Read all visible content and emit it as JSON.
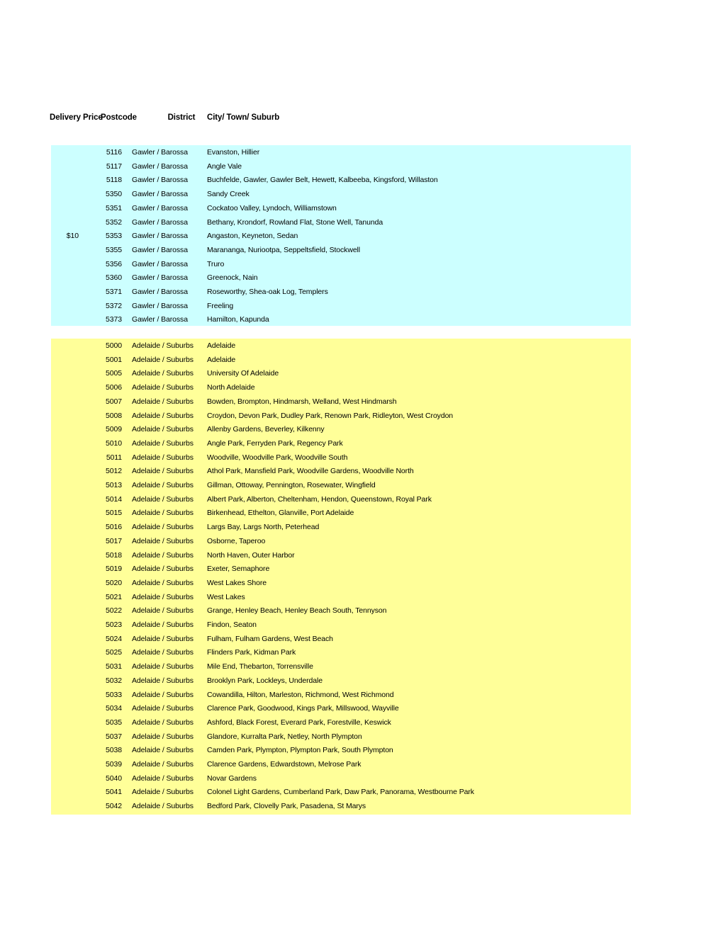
{
  "table": {
    "headers": {
      "delivery_price": "Delivery Price",
      "postcode": "Postcode",
      "district": "District",
      "city_town_suburb": "City/ Town/ Suburb"
    },
    "colors": {
      "gawler_block": "#CCFFFF",
      "adelaide_block": "#FFFF99"
    },
    "sections": [
      {
        "name": "gawler-barossa",
        "highlight_color": "#CCFFFF",
        "price_label": "$10",
        "price_row_index": 6,
        "rows": [
          {
            "price": "",
            "postcode": "5116",
            "district": "Gawler / Barossa",
            "city": "Evanston, Hillier"
          },
          {
            "price": "",
            "postcode": "5117",
            "district": "Gawler / Barossa",
            "city": "Angle Vale"
          },
          {
            "price": "",
            "postcode": "5118",
            "district": "Gawler / Barossa",
            "city": "Buchfelde, Gawler, Gawler Belt, Hewett, Kalbeeba, Kingsford, Willaston"
          },
          {
            "price": "",
            "postcode": "5350",
            "district": "Gawler / Barossa",
            "city": "Sandy Creek"
          },
          {
            "price": "",
            "postcode": "5351",
            "district": "Gawler / Barossa",
            "city": "Cockatoo Valley, Lyndoch, Williamstown"
          },
          {
            "price": "",
            "postcode": "5352",
            "district": "Gawler / Barossa",
            "city": "Bethany, Krondorf, Rowland Flat, Stone Well, Tanunda"
          },
          {
            "price": "$10",
            "postcode": "5353",
            "district": "Gawler / Barossa",
            "city": "Angaston, Keyneton, Sedan"
          },
          {
            "price": "",
            "postcode": "5355",
            "district": "Gawler / Barossa",
            "city": "Marananga, Nuriootpa, Seppeltsfield, Stockwell"
          },
          {
            "price": "",
            "postcode": "5356",
            "district": "Gawler / Barossa",
            "city": "Truro"
          },
          {
            "price": "",
            "postcode": "5360",
            "district": "Gawler / Barossa",
            "city": "Greenock, Nain"
          },
          {
            "price": "",
            "postcode": "5371",
            "district": "Gawler / Barossa",
            "city": "Roseworthy, Shea-oak Log, Templers"
          },
          {
            "price": "",
            "postcode": "5372",
            "district": "Gawler / Barossa",
            "city": "Freeling"
          },
          {
            "price": "",
            "postcode": "5373",
            "district": "Gawler / Barossa",
            "city": "Hamilton, Kapunda"
          }
        ]
      },
      {
        "name": "adelaide-suburbs",
        "highlight_color": "#FFFF99",
        "price_label": "",
        "price_row_index": -1,
        "rows": [
          {
            "price": "",
            "postcode": "5000",
            "district": "Adelaide / Suburbs",
            "city": "Adelaide"
          },
          {
            "price": "",
            "postcode": "5001",
            "district": "Adelaide / Suburbs",
            "city": "Adelaide"
          },
          {
            "price": "",
            "postcode": "5005",
            "district": "Adelaide / Suburbs",
            "city": "University Of Adelaide"
          },
          {
            "price": "",
            "postcode": "5006",
            "district": "Adelaide / Suburbs",
            "city": "North Adelaide"
          },
          {
            "price": "",
            "postcode": "5007",
            "district": "Adelaide / Suburbs",
            "city": "Bowden, Brompton, Hindmarsh, Welland, West Hindmarsh"
          },
          {
            "price": "",
            "postcode": "5008",
            "district": "Adelaide / Suburbs",
            "city": "Croydon, Devon Park, Dudley Park, Renown Park, Ridleyton, West Croydon"
          },
          {
            "price": "",
            "postcode": "5009",
            "district": "Adelaide / Suburbs",
            "city": "Allenby Gardens, Beverley, Kilkenny"
          },
          {
            "price": "",
            "postcode": "5010",
            "district": "Adelaide / Suburbs",
            "city": "Angle Park, Ferryden Park, Regency Park"
          },
          {
            "price": "",
            "postcode": "5011",
            "district": "Adelaide / Suburbs",
            "city": "Woodville, Woodville Park, Woodville South"
          },
          {
            "price": "",
            "postcode": "5012",
            "district": "Adelaide / Suburbs",
            "city": "Athol Park, Mansfield Park, Woodville Gardens, Woodville North"
          },
          {
            "price": "",
            "postcode": "5013",
            "district": "Adelaide / Suburbs",
            "city": "Gillman, Ottoway, Pennington, Rosewater, Wingfield"
          },
          {
            "price": "",
            "postcode": "5014",
            "district": "Adelaide / Suburbs",
            "city": "Albert Park, Alberton, Cheltenham, Hendon, Queenstown, Royal Park"
          },
          {
            "price": "",
            "postcode": "5015",
            "district": "Adelaide / Suburbs",
            "city": "Birkenhead, Ethelton, Glanville, Port Adelaide"
          },
          {
            "price": "",
            "postcode": "5016",
            "district": "Adelaide / Suburbs",
            "city": "Largs Bay, Largs North, Peterhead"
          },
          {
            "price": "",
            "postcode": "5017",
            "district": "Adelaide / Suburbs",
            "city": "Osborne, Taperoo"
          },
          {
            "price": "",
            "postcode": "5018",
            "district": "Adelaide / Suburbs",
            "city": "North Haven, Outer Harbor"
          },
          {
            "price": "",
            "postcode": "5019",
            "district": "Adelaide / Suburbs",
            "city": "Exeter, Semaphore"
          },
          {
            "price": "",
            "postcode": "5020",
            "district": "Adelaide / Suburbs",
            "city": "West Lakes Shore"
          },
          {
            "price": "",
            "postcode": "5021",
            "district": "Adelaide / Suburbs",
            "city": "West Lakes"
          },
          {
            "price": "",
            "postcode": "5022",
            "district": "Adelaide / Suburbs",
            "city": "Grange, Henley Beach, Henley Beach South, Tennyson"
          },
          {
            "price": "",
            "postcode": "5023",
            "district": "Adelaide / Suburbs",
            "city": "Findon, Seaton"
          },
          {
            "price": "",
            "postcode": "5024",
            "district": "Adelaide / Suburbs",
            "city": "Fulham, Fulham Gardens, West Beach"
          },
          {
            "price": "",
            "postcode": "5025",
            "district": "Adelaide / Suburbs",
            "city": "Flinders Park, Kidman Park"
          },
          {
            "price": "",
            "postcode": "5031",
            "district": "Adelaide / Suburbs",
            "city": "Mile End, Thebarton, Torrensville"
          },
          {
            "price": "",
            "postcode": "5032",
            "district": "Adelaide / Suburbs",
            "city": "Brooklyn Park, Lockleys, Underdale"
          },
          {
            "price": "",
            "postcode": "5033",
            "district": "Adelaide / Suburbs",
            "city": "Cowandilla, Hilton, Marleston, Richmond, West Richmond"
          },
          {
            "price": "",
            "postcode": "5034",
            "district": "Adelaide / Suburbs",
            "city": "Clarence Park, Goodwood, Kings Park, Millswood, Wayville"
          },
          {
            "price": "",
            "postcode": "5035",
            "district": "Adelaide / Suburbs",
            "city": "Ashford, Black Forest, Everard Park, Forestville, Keswick"
          },
          {
            "price": "",
            "postcode": "5037",
            "district": "Adelaide / Suburbs",
            "city": "Glandore, Kurralta Park, Netley, North Plympton"
          },
          {
            "price": "",
            "postcode": "5038",
            "district": "Adelaide / Suburbs",
            "city": "Camden Park, Plympton, Plympton Park, South Plympton"
          },
          {
            "price": "",
            "postcode": "5039",
            "district": "Adelaide / Suburbs",
            "city": "Clarence Gardens, Edwardstown, Melrose Park"
          },
          {
            "price": "",
            "postcode": "5040",
            "district": "Adelaide / Suburbs",
            "city": "Novar Gardens"
          },
          {
            "price": "",
            "postcode": "5041",
            "district": "Adelaide / Suburbs",
            "city": "Colonel Light Gardens, Cumberland Park, Daw Park, Panorama, Westbourne Park"
          },
          {
            "price": "",
            "postcode": "5042",
            "district": "Adelaide / Suburbs",
            "city": "Bedford Park, Clovelly Park, Pasadena, St Marys"
          }
        ]
      }
    ]
  }
}
